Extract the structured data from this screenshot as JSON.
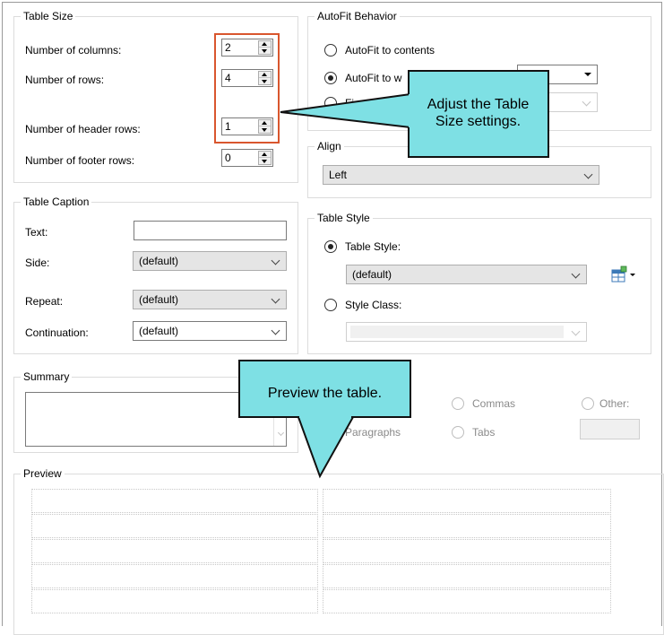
{
  "table_size": {
    "title": "Table Size",
    "columns_label": "Number of columns:",
    "columns_value": "2",
    "rows_label": "Number of rows:",
    "rows_value": "4",
    "header_label": "Number of header rows:",
    "header_value": "1",
    "footer_label": "Number of footer rows:",
    "footer_value": "0"
  },
  "autofit": {
    "title": "AutoFit Behavior",
    "contents_label": "AutoFit to contents",
    "window_label": "AutoFit to w",
    "fixed_label": "Fi",
    "selected": "window"
  },
  "align": {
    "title": "Align",
    "value": "Left"
  },
  "caption": {
    "title": "Table Caption",
    "text_label": "Text:",
    "text_value": "",
    "side_label": "Side:",
    "side_value": "(default)",
    "repeat_label": "Repeat:",
    "repeat_value": "(default)",
    "continuation_label": "Continuation:",
    "continuation_value": "(default)"
  },
  "table_style": {
    "title": "Table Style",
    "style_label": "Table Style:",
    "style_value": "(default)",
    "class_label": "Style Class:",
    "class_value": "",
    "selected": "table_style"
  },
  "summary": {
    "title": "Summary"
  },
  "separator": {
    "commas_label": "Commas",
    "other_label": "Other:",
    "paragraphs_label": "Paragraphs",
    "tabs_label": "Tabs"
  },
  "preview": {
    "title": "Preview",
    "columns": 2,
    "rows": 5
  },
  "callouts": {
    "table_size": "Adjust the Table Size settings.",
    "preview": "Preview the table."
  },
  "colors": {
    "callout_fill": "#7ee0e4",
    "highlight_border": "#d9562e"
  },
  "icons": {
    "style_picker": "table-style-picker-icon"
  }
}
